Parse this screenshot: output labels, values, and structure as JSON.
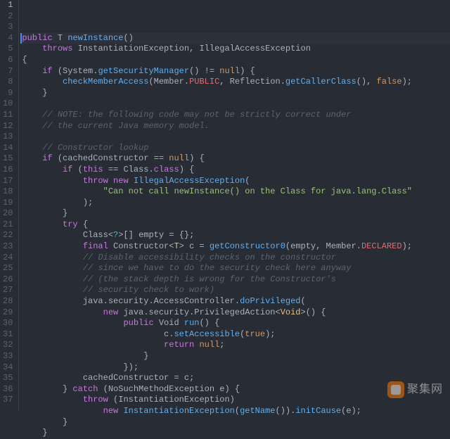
{
  "chart_data": null,
  "watermark": {
    "text": "聚集网"
  },
  "lines": [
    {
      "n": 1,
      "active": true,
      "tokens": [
        {
          "cls": "tk-keyword",
          "t": "public"
        },
        {
          "cls": "tk-plain",
          "t": " T "
        },
        {
          "cls": "tk-funcdef",
          "t": "newInstance"
        },
        {
          "cls": "tk-punc",
          "t": "()"
        }
      ]
    },
    {
      "n": 2,
      "tokens": [
        {
          "cls": "tk-plain",
          "t": "    "
        },
        {
          "cls": "tk-keyword",
          "t": "throws"
        },
        {
          "cls": "tk-plain",
          "t": " InstantiationException, IllegalAccessException"
        }
      ]
    },
    {
      "n": 3,
      "tokens": [
        {
          "cls": "tk-punc",
          "t": "{"
        }
      ]
    },
    {
      "n": 4,
      "tokens": [
        {
          "cls": "tk-plain",
          "t": "    "
        },
        {
          "cls": "tk-keyword",
          "t": "if"
        },
        {
          "cls": "tk-plain",
          "t": " (System."
        },
        {
          "cls": "tk-func",
          "t": "getSecurityManager"
        },
        {
          "cls": "tk-punc",
          "t": "() "
        },
        {
          "cls": "tk-op",
          "t": "!= "
        },
        {
          "cls": "tk-bool",
          "t": "null"
        },
        {
          "cls": "tk-punc",
          "t": ") {"
        }
      ]
    },
    {
      "n": 5,
      "tokens": [
        {
          "cls": "tk-plain",
          "t": "        "
        },
        {
          "cls": "tk-func",
          "t": "checkMemberAccess"
        },
        {
          "cls": "tk-punc",
          "t": "("
        },
        {
          "cls": "tk-plain",
          "t": "Member"
        },
        {
          "cls": "tk-punc",
          "t": "."
        },
        {
          "cls": "tk-var",
          "t": "PUBLIC"
        },
        {
          "cls": "tk-punc",
          "t": ", "
        },
        {
          "cls": "tk-plain",
          "t": "Reflection"
        },
        {
          "cls": "tk-punc",
          "t": "."
        },
        {
          "cls": "tk-func",
          "t": "getCallerClass"
        },
        {
          "cls": "tk-punc",
          "t": "(), "
        },
        {
          "cls": "tk-bool",
          "t": "false"
        },
        {
          "cls": "tk-punc",
          "t": ");"
        }
      ]
    },
    {
      "n": 6,
      "tokens": [
        {
          "cls": "tk-plain",
          "t": "    "
        },
        {
          "cls": "tk-punc",
          "t": "}"
        }
      ]
    },
    {
      "n": 7,
      "tokens": [
        {
          "cls": "tk-plain",
          "t": ""
        }
      ]
    },
    {
      "n": 8,
      "tokens": [
        {
          "cls": "tk-plain",
          "t": "    "
        },
        {
          "cls": "tk-comment",
          "t": "// NOTE: the following code may not be strictly correct under"
        }
      ]
    },
    {
      "n": 9,
      "tokens": [
        {
          "cls": "tk-plain",
          "t": "    "
        },
        {
          "cls": "tk-comment",
          "t": "// the current Java memory model."
        }
      ]
    },
    {
      "n": 10,
      "tokens": [
        {
          "cls": "tk-plain",
          "t": ""
        }
      ]
    },
    {
      "n": 11,
      "tokens": [
        {
          "cls": "tk-plain",
          "t": "    "
        },
        {
          "cls": "tk-comment",
          "t": "// Constructor lookup"
        }
      ]
    },
    {
      "n": 12,
      "tokens": [
        {
          "cls": "tk-plain",
          "t": "    "
        },
        {
          "cls": "tk-keyword",
          "t": "if"
        },
        {
          "cls": "tk-plain",
          "t": " (cachedConstructor "
        },
        {
          "cls": "tk-op",
          "t": "== "
        },
        {
          "cls": "tk-bool",
          "t": "null"
        },
        {
          "cls": "tk-punc",
          "t": ") {"
        }
      ]
    },
    {
      "n": 13,
      "tokens": [
        {
          "cls": "tk-plain",
          "t": "        "
        },
        {
          "cls": "tk-keyword",
          "t": "if"
        },
        {
          "cls": "tk-plain",
          "t": " ("
        },
        {
          "cls": "tk-keyword",
          "t": "this"
        },
        {
          "cls": "tk-plain",
          "t": " "
        },
        {
          "cls": "tk-op",
          "t": "== "
        },
        {
          "cls": "tk-plain",
          "t": "Class"
        },
        {
          "cls": "tk-punc",
          "t": "."
        },
        {
          "cls": "tk-keyword",
          "t": "class"
        },
        {
          "cls": "tk-punc",
          "t": ") {"
        }
      ]
    },
    {
      "n": 14,
      "tokens": [
        {
          "cls": "tk-plain",
          "t": "            "
        },
        {
          "cls": "tk-keyword",
          "t": "throw"
        },
        {
          "cls": "tk-plain",
          "t": " "
        },
        {
          "cls": "tk-keyword",
          "t": "new"
        },
        {
          "cls": "tk-plain",
          "t": " "
        },
        {
          "cls": "tk-func",
          "t": "IllegalAccessException"
        },
        {
          "cls": "tk-punc",
          "t": "("
        }
      ]
    },
    {
      "n": 15,
      "tokens": [
        {
          "cls": "tk-plain",
          "t": "                "
        },
        {
          "cls": "tk-str",
          "t": "\"Can not call newInstance() on the Class for java.lang.Class\""
        }
      ]
    },
    {
      "n": 16,
      "tokens": [
        {
          "cls": "tk-plain",
          "t": "            "
        },
        {
          "cls": "tk-punc",
          "t": ");"
        }
      ]
    },
    {
      "n": 17,
      "tokens": [
        {
          "cls": "tk-plain",
          "t": "        "
        },
        {
          "cls": "tk-punc",
          "t": "}"
        }
      ]
    },
    {
      "n": 18,
      "tokens": [
        {
          "cls": "tk-plain",
          "t": "        "
        },
        {
          "cls": "tk-keyword",
          "t": "try"
        },
        {
          "cls": "tk-punc",
          "t": " {"
        }
      ]
    },
    {
      "n": 19,
      "tokens": [
        {
          "cls": "tk-plain",
          "t": "            "
        },
        {
          "cls": "tk-plain",
          "t": "Class"
        },
        {
          "cls": "tk-punc",
          "t": "<"
        },
        {
          "cls": "tk-gen",
          "t": "?"
        },
        {
          "cls": "tk-punc",
          "t": ">[] "
        },
        {
          "cls": "tk-plain",
          "t": "empty "
        },
        {
          "cls": "tk-op",
          "t": "= "
        },
        {
          "cls": "tk-punc",
          "t": "{};"
        }
      ]
    },
    {
      "n": 20,
      "tokens": [
        {
          "cls": "tk-plain",
          "t": "            "
        },
        {
          "cls": "tk-keyword",
          "t": "final"
        },
        {
          "cls": "tk-plain",
          "t": " Constructor"
        },
        {
          "cls": "tk-punc",
          "t": "<"
        },
        {
          "cls": "tk-class",
          "t": "T"
        },
        {
          "cls": "tk-punc",
          "t": "> "
        },
        {
          "cls": "tk-plain",
          "t": "c "
        },
        {
          "cls": "tk-op",
          "t": "= "
        },
        {
          "cls": "tk-func",
          "t": "getConstructor0"
        },
        {
          "cls": "tk-punc",
          "t": "("
        },
        {
          "cls": "tk-plain",
          "t": "empty"
        },
        {
          "cls": "tk-punc",
          "t": ", "
        },
        {
          "cls": "tk-plain",
          "t": "Member"
        },
        {
          "cls": "tk-punc",
          "t": "."
        },
        {
          "cls": "tk-var",
          "t": "DECLARED"
        },
        {
          "cls": "tk-punc",
          "t": ");"
        }
      ]
    },
    {
      "n": 21,
      "tokens": [
        {
          "cls": "tk-plain",
          "t": "            "
        },
        {
          "cls": "tk-comment",
          "t": "// Disable accessibility checks on the constructor"
        }
      ]
    },
    {
      "n": 22,
      "tokens": [
        {
          "cls": "tk-plain",
          "t": "            "
        },
        {
          "cls": "tk-comment",
          "t": "// since we have to do the security check here anyway"
        }
      ]
    },
    {
      "n": 23,
      "tokens": [
        {
          "cls": "tk-plain",
          "t": "            "
        },
        {
          "cls": "tk-comment",
          "t": "// (the stack depth is wrong for the Constructor's"
        }
      ]
    },
    {
      "n": 24,
      "tokens": [
        {
          "cls": "tk-plain",
          "t": "            "
        },
        {
          "cls": "tk-comment",
          "t": "// security check to work)"
        }
      ]
    },
    {
      "n": 25,
      "tokens": [
        {
          "cls": "tk-plain",
          "t": "            "
        },
        {
          "cls": "tk-plain",
          "t": "java"
        },
        {
          "cls": "tk-punc",
          "t": "."
        },
        {
          "cls": "tk-plain",
          "t": "security"
        },
        {
          "cls": "tk-punc",
          "t": "."
        },
        {
          "cls": "tk-plain",
          "t": "AccessController"
        },
        {
          "cls": "tk-punc",
          "t": "."
        },
        {
          "cls": "tk-func",
          "t": "doPrivileged"
        },
        {
          "cls": "tk-punc",
          "t": "("
        }
      ]
    },
    {
      "n": 26,
      "tokens": [
        {
          "cls": "tk-plain",
          "t": "                "
        },
        {
          "cls": "tk-keyword",
          "t": "new"
        },
        {
          "cls": "tk-plain",
          "t": " java"
        },
        {
          "cls": "tk-punc",
          "t": "."
        },
        {
          "cls": "tk-plain",
          "t": "security"
        },
        {
          "cls": "tk-punc",
          "t": "."
        },
        {
          "cls": "tk-plain",
          "t": "PrivilegedAction"
        },
        {
          "cls": "tk-punc",
          "t": "<"
        },
        {
          "cls": "tk-class",
          "t": "Void"
        },
        {
          "cls": "tk-punc",
          "t": ">() {"
        }
      ]
    },
    {
      "n": 27,
      "tokens": [
        {
          "cls": "tk-plain",
          "t": "                    "
        },
        {
          "cls": "tk-keyword",
          "t": "public"
        },
        {
          "cls": "tk-plain",
          "t": " Void "
        },
        {
          "cls": "tk-funcdef",
          "t": "run"
        },
        {
          "cls": "tk-punc",
          "t": "() {"
        }
      ]
    },
    {
      "n": 28,
      "tokens": [
        {
          "cls": "tk-plain",
          "t": "                            "
        },
        {
          "cls": "tk-plain",
          "t": "c"
        },
        {
          "cls": "tk-punc",
          "t": "."
        },
        {
          "cls": "tk-func",
          "t": "setAccessible"
        },
        {
          "cls": "tk-punc",
          "t": "("
        },
        {
          "cls": "tk-bool",
          "t": "true"
        },
        {
          "cls": "tk-punc",
          "t": ");"
        }
      ]
    },
    {
      "n": 29,
      "tokens": [
        {
          "cls": "tk-plain",
          "t": "                            "
        },
        {
          "cls": "tk-keyword",
          "t": "return"
        },
        {
          "cls": "tk-plain",
          "t": " "
        },
        {
          "cls": "tk-bool",
          "t": "null"
        },
        {
          "cls": "tk-punc",
          "t": ";"
        }
      ]
    },
    {
      "n": 30,
      "tokens": [
        {
          "cls": "tk-plain",
          "t": "                        "
        },
        {
          "cls": "tk-punc",
          "t": "}"
        }
      ]
    },
    {
      "n": 31,
      "tokens": [
        {
          "cls": "tk-plain",
          "t": "                    "
        },
        {
          "cls": "tk-punc",
          "t": "});"
        }
      ]
    },
    {
      "n": 32,
      "tokens": [
        {
          "cls": "tk-plain",
          "t": "            "
        },
        {
          "cls": "tk-plain",
          "t": "cachedConstructor "
        },
        {
          "cls": "tk-op",
          "t": "= "
        },
        {
          "cls": "tk-plain",
          "t": "c"
        },
        {
          "cls": "tk-punc",
          "t": ";"
        }
      ]
    },
    {
      "n": 33,
      "tokens": [
        {
          "cls": "tk-plain",
          "t": "        "
        },
        {
          "cls": "tk-punc",
          "t": "} "
        },
        {
          "cls": "tk-keyword",
          "t": "catch"
        },
        {
          "cls": "tk-plain",
          "t": " (NoSuchMethodException e"
        },
        {
          "cls": "tk-punc",
          "t": ") {"
        }
      ]
    },
    {
      "n": 34,
      "tokens": [
        {
          "cls": "tk-plain",
          "t": "            "
        },
        {
          "cls": "tk-keyword",
          "t": "throw"
        },
        {
          "cls": "tk-plain",
          "t": " (InstantiationException)"
        }
      ]
    },
    {
      "n": 35,
      "tokens": [
        {
          "cls": "tk-plain",
          "t": "                "
        },
        {
          "cls": "tk-keyword",
          "t": "new"
        },
        {
          "cls": "tk-plain",
          "t": " "
        },
        {
          "cls": "tk-func",
          "t": "InstantiationException"
        },
        {
          "cls": "tk-punc",
          "t": "("
        },
        {
          "cls": "tk-func",
          "t": "getName"
        },
        {
          "cls": "tk-punc",
          "t": "())."
        },
        {
          "cls": "tk-func",
          "t": "initCause"
        },
        {
          "cls": "tk-punc",
          "t": "("
        },
        {
          "cls": "tk-plain",
          "t": "e"
        },
        {
          "cls": "tk-punc",
          "t": ");"
        }
      ]
    },
    {
      "n": 36,
      "tokens": [
        {
          "cls": "tk-plain",
          "t": "        "
        },
        {
          "cls": "tk-punc",
          "t": "}"
        }
      ]
    },
    {
      "n": 37,
      "tokens": [
        {
          "cls": "tk-plain",
          "t": "    "
        },
        {
          "cls": "tk-punc",
          "t": "}"
        }
      ]
    }
  ]
}
